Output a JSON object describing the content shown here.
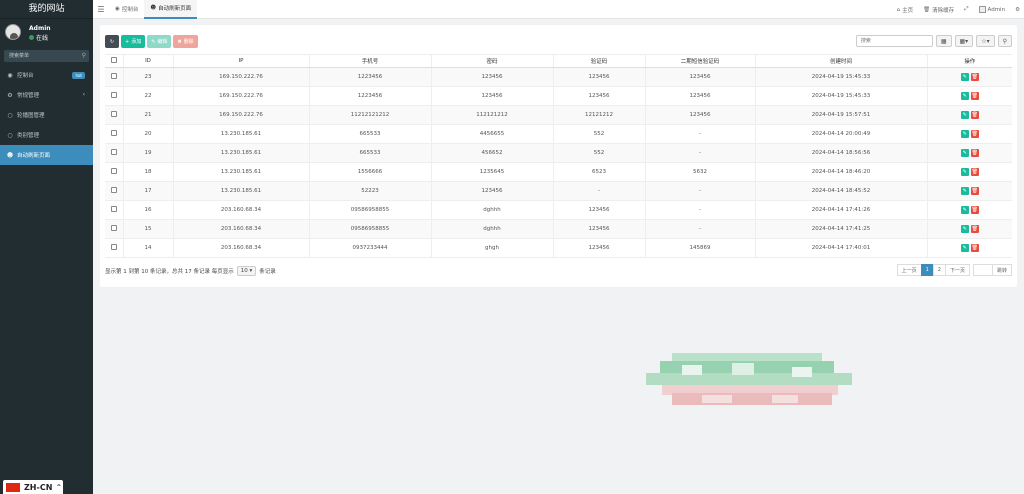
{
  "sidebar": {
    "brand": "我的网站",
    "user": {
      "name": "Admin",
      "status": "在线"
    },
    "search_placeholder": "搜索菜单",
    "items": [
      {
        "label": "控制台",
        "icon": "dashboard-icon",
        "badge": "hot"
      },
      {
        "label": "常规管理",
        "icon": "cogs-icon",
        "chevron": "‹"
      },
      {
        "label": "轮播图管理",
        "icon": "circle-icon"
      },
      {
        "label": "类别管理",
        "icon": "circle-icon"
      },
      {
        "label": "自动刷新页面",
        "icon": "users-icon"
      }
    ]
  },
  "lang": {
    "label": "ZH-CN",
    "caret": "^"
  },
  "topbar": {
    "tabs": [
      {
        "label": "控制台"
      },
      {
        "label": "自动刷新页面"
      }
    ],
    "home": "主页",
    "clear_cache": "清除缓存",
    "admin": "Admin"
  },
  "toolbar": {
    "add": "添加",
    "edit": "编辑",
    "delete": "删除",
    "search_placeholder": "搜索"
  },
  "table": {
    "headers": [
      "ID",
      "IP",
      "手机号",
      "密码",
      "验证码",
      "二期短信验证码",
      "创建时间",
      "操作"
    ],
    "rows": [
      [
        "23",
        "169.150.222.76",
        "1223456",
        "123456",
        "123456",
        "123456",
        "2024-04-19 15:45:33"
      ],
      [
        "22",
        "169.150.222.76",
        "1223456",
        "123456",
        "123456",
        "123456",
        "2024-04-19 15:45:33"
      ],
      [
        "21",
        "169.150.222.76",
        "11212121212",
        "112121212",
        "12121212",
        "123456",
        "2024-04-19 15:57:51"
      ],
      [
        "20",
        "13.230.185.61",
        "665533",
        "4456655",
        "552",
        "-",
        "2024-04-14 20:00:49"
      ],
      [
        "19",
        "13.230.185.61",
        "665533",
        "456652",
        "552",
        "-",
        "2024-04-14 18:56:56"
      ],
      [
        "18",
        "13.230.185.61",
        "1556666",
        "1235645",
        "6523",
        "5632",
        "2024-04-14 18:46:20"
      ],
      [
        "17",
        "13.230.185.61",
        "52223",
        "123456",
        "-",
        "-",
        "2024-04-14 18:45:52"
      ],
      [
        "16",
        "203.160.68.34",
        "09586958855",
        "dghhh",
        "123456",
        "-",
        "2024-04-14 17:41:26"
      ],
      [
        "15",
        "203.160.68.34",
        "09586958855",
        "dghhh",
        "123456",
        "-",
        "2024-04-14 17:41:25"
      ],
      [
        "14",
        "203.160.68.34",
        "0937233444",
        "ghgh",
        "123456",
        "145869",
        "2024-04-14 17:40:01"
      ]
    ]
  },
  "pagination": {
    "info_prefix": "显示第 1 到第 10 条记录，总共 17 条记录 每页显示",
    "page_size": "10",
    "info_suffix": "条记录",
    "prev": "上一页",
    "pages": [
      "1",
      "2"
    ],
    "next": "下一页",
    "jump": "跳转"
  },
  "colors": {
    "primary": "#3c8dbc",
    "success": "#18bc9c",
    "danger": "#e74c3c",
    "sidebar": "#222d32"
  }
}
